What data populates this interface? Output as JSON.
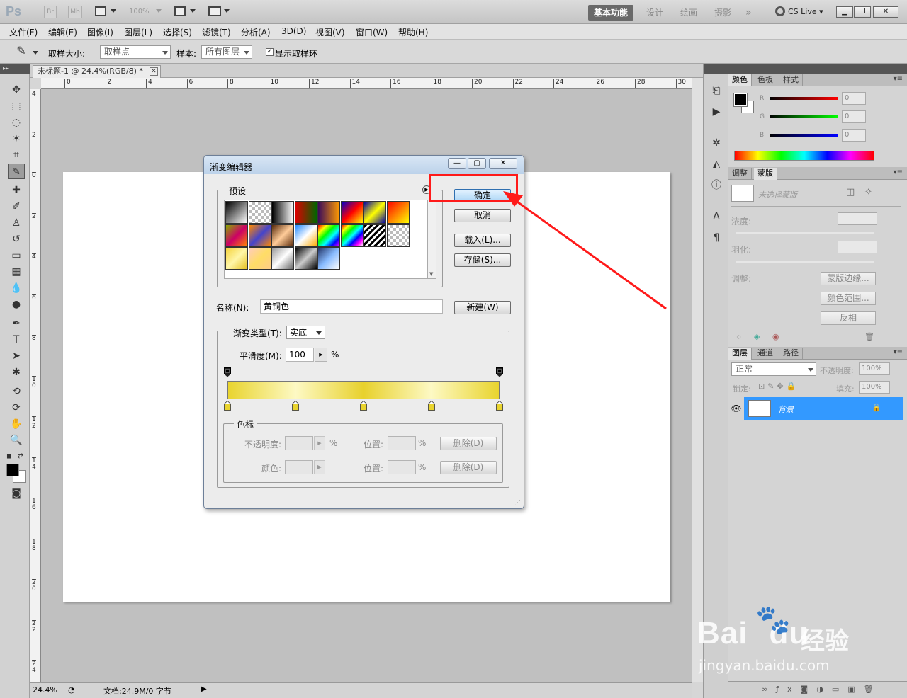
{
  "app": {
    "logo": "Ps",
    "br": "Br",
    "mb": "Mb",
    "zoom": "100%",
    "workspaces": [
      "基本功能",
      "设计",
      "绘画",
      "摄影"
    ],
    "more": "»",
    "cslive": "CS Live"
  },
  "menu": [
    "文件(F)",
    "编辑(E)",
    "图像(I)",
    "图层(L)",
    "选择(S)",
    "滤镜(T)",
    "分析(A)",
    "3D(D)",
    "视图(V)",
    "窗口(W)",
    "帮助(H)"
  ],
  "options": {
    "sample_size_label": "取样大小:",
    "sample_size_value": "取样点",
    "sample_label": "样本:",
    "sample_value": "所有图层",
    "show_ring_label": "显示取样环"
  },
  "document": {
    "tab_title": "未标题-1 @ 24.4%(RGB/8) *",
    "ruler_top": [
      "0",
      "2",
      "4",
      "6",
      "8",
      "10",
      "12",
      "14",
      "16",
      "18",
      "20",
      "22",
      "24",
      "26",
      "28",
      "30"
    ],
    "ruler_left": [
      "4",
      "2",
      "0",
      "2",
      "4",
      "6",
      "8",
      "1\n0",
      "1\n2",
      "1\n4",
      "1\n6",
      "1\n8",
      "2\n0",
      "2\n2",
      "2\n4"
    ],
    "status_zoom": "24.4%",
    "status_doc": "文档:24.9M/0 字节"
  },
  "color_panel": {
    "tabs": [
      "颜色",
      "色板",
      "样式"
    ],
    "r_label": "R",
    "g_label": "G",
    "b_label": "B",
    "r": "0",
    "g": "0",
    "b": "0"
  },
  "mask_panel": {
    "tabs": [
      "调整",
      "蒙版"
    ],
    "no_mask": "未选择蒙版",
    "density": "浓度:",
    "feather": "羽化:",
    "adjust": "调整:",
    "mask_edge": "蒙版边缘...",
    "color_range": "颜色范围...",
    "invert": "反相"
  },
  "layers_panel": {
    "tabs": [
      "图层",
      "通道",
      "路径"
    ],
    "blend_mode": "正常",
    "opacity_label": "不透明度:",
    "opacity": "100%",
    "lock_label": "锁定:",
    "fill_label": "填充:",
    "fill": "100%",
    "layer_name": "背景"
  },
  "dialog": {
    "title": "渐变编辑器",
    "presets_label": "预设",
    "ok": "确定",
    "cancel": "取消",
    "load": "载入(L)...",
    "save": "存储(S)...",
    "name_label": "名称(N):",
    "name_value": "黄铜色",
    "new": "新建(W)",
    "type_label": "渐变类型(T):",
    "type_value": "实底",
    "smooth_label": "平滑度(M):",
    "smooth_value": "100",
    "percent": "%",
    "stops_label": "色标",
    "opacity_label": "不透明度:",
    "position_label": "位置:",
    "color_label": "颜色:",
    "delete": "删除(D)",
    "swatches": [
      "linear-gradient(135deg,#000,#fff)",
      "repeating-conic-gradient(#bbb 0 25%,#fff 0 50%) 0 0/8px 8px",
      "linear-gradient(90deg,#000,#fff)",
      "linear-gradient(90deg,#d00,#060)",
      "linear-gradient(90deg,#3a0a5a,#ff9a00)",
      "linear-gradient(135deg,#00c,#f00,#ff0)",
      "linear-gradient(135deg,#00a,#ff0,#00a)",
      "linear-gradient(135deg,#f00,#ff0)",
      "linear-gradient(135deg,#8a0,#c06,#f80)",
      "linear-gradient(135deg,#f80,#44c,#f80)",
      "linear-gradient(135deg,#5a2a0a,#fc9,#5a2a0a)",
      "linear-gradient(135deg,#28f,#fff,#fa0)",
      "linear-gradient(135deg,#f00,#ff0,#0f0,#0ff,#00f,#f0f)",
      "linear-gradient(135deg,#f00,#ff0,#0f0,#0ff,#00f,#f0f,#fff)",
      "repeating-linear-gradient(135deg,#000 0 3px,#fff 3px 6px)",
      "repeating-conic-gradient(#bbb 0 25%,#fff 0 50%) 0 0/8px 8px",
      "linear-gradient(135deg,#f4d23a,#fff6a8,#e6c020)",
      "linear-gradient(135deg,#fcb,#fd6,#fc8)",
      "linear-gradient(135deg,#999,#fff,#666)",
      "linear-gradient(135deg,#000,#ccc,#000)",
      "linear-gradient(135deg,#236,#8bf,#fff)"
    ],
    "gradient_bar": "linear-gradient(90deg,#e9d42e 0%,#fdf9c4 25%,#e8d12c 50%,#fdf9c4 75%,#e9d42e 100%)",
    "stop_color": "#e9d42e",
    "color_stops": [
      0,
      25,
      50,
      75,
      100
    ],
    "opacity_stops": [
      0,
      100
    ]
  },
  "watermark": {
    "logo": "Bai",
    "logo2": "du",
    "cn": "经验",
    "url": "jingyan.baidu.com"
  },
  "colors": {
    "highlight": "#ff1a1a",
    "layer_selected": "#3399ff"
  }
}
